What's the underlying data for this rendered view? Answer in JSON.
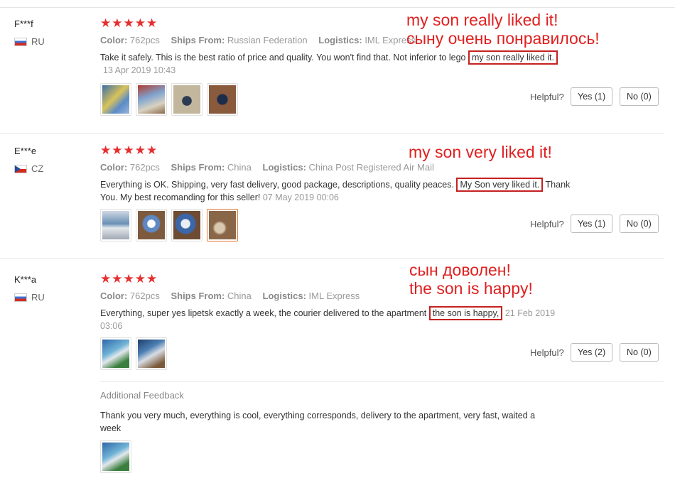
{
  "reviews": [
    {
      "user": "F***f",
      "country": "RU",
      "stars": "★★★★★",
      "color_label": "Color:",
      "color_value": "762pcs",
      "ships_label": "Ships From:",
      "ships_value": "Russian Federation",
      "logistics_label": "Logistics:",
      "logistics_value": "IML Express",
      "text_before": "Take it safely. This is the best ratio of price and quality. You won't find that. Not inferior to lego",
      "text_highlight": "my son really liked it.",
      "text_after": "",
      "date": "13 Apr 2019 10:43",
      "helpful_label": "Helpful?",
      "yes_label": "Yes (1)",
      "no_label": "No (0)",
      "annotation_1": "my son really liked it!",
      "annotation_2": "сыну очень понравилось!"
    },
    {
      "user": "E***e",
      "country": "CZ",
      "stars": "★★★★★",
      "color_label": "Color:",
      "color_value": "762pcs",
      "ships_label": "Ships From:",
      "ships_value": "China",
      "logistics_label": "Logistics:",
      "logistics_value": "China Post Registered Air Mail",
      "text_before": "Everything is OK. Shipping, very fast delivery, good package, descriptions, quality peaces.",
      "text_highlight": "My Son very liked it.",
      "text_after": "Thank",
      "text_line2": "You. My best recomanding for this seller!",
      "date": "07 May 2019 00:06",
      "helpful_label": "Helpful?",
      "yes_label": "Yes (1)",
      "no_label": "No (0)",
      "annotation_1": "my son very liked it!"
    },
    {
      "user": "K***a",
      "country": "RU",
      "stars": "★★★★★",
      "color_label": "Color:",
      "color_value": "762pcs",
      "ships_label": "Ships From:",
      "ships_value": "China",
      "logistics_label": "Logistics:",
      "logistics_value": "IML Express",
      "text_before": "Everything, super yes lipetsk exactly a week, the courier delivered to the apartment",
      "text_highlight": "the son is happy,",
      "date_part1": "21 Feb 2019",
      "date_part2": "03:06",
      "helpful_label": "Helpful?",
      "yes_label": "Yes (2)",
      "no_label": "No (0)",
      "annotation_1": "сын доволен!",
      "annotation_2": "the son is happy!",
      "additional_title": "Additional Feedback",
      "additional_line1": "Thank you very much, everything is cool, everything corresponds, delivery to the apartment, very fast, waited a",
      "additional_line2": "week"
    }
  ],
  "colors": {
    "star": "#e62e2e",
    "annotation": "#e02020",
    "highlight_border": "#c62020"
  }
}
